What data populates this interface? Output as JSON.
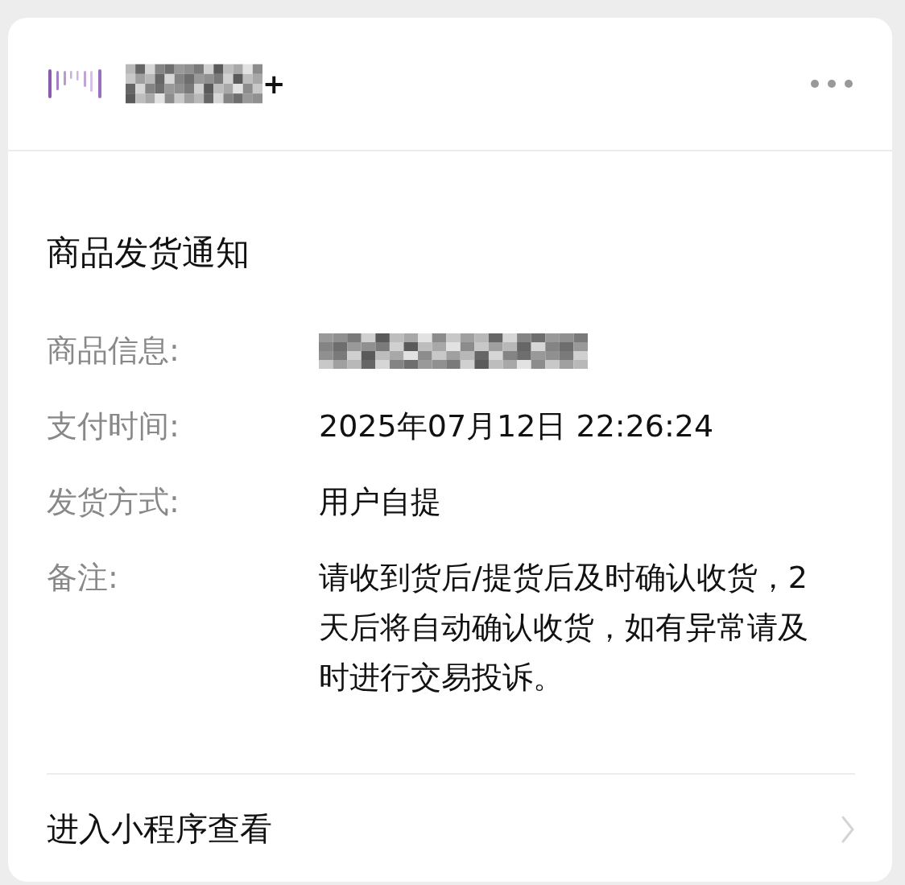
{
  "header": {
    "name_redacted": true,
    "name_suffix": "+"
  },
  "title": "商品发货通知",
  "fields": [
    {
      "label": "商品信息:",
      "kind": "redacted"
    },
    {
      "label": "支付时间:",
      "kind": "text",
      "value": "2025年07月12日 22:26:24"
    },
    {
      "label": "发货方式:",
      "kind": "text",
      "value": "用户自提"
    },
    {
      "label": "备注:",
      "kind": "text",
      "value": "请收到货后/提货后及时确认收货，2天后将自动确认收货，如有异常请及时进行交易投诉。"
    }
  ],
  "footer": {
    "link": "进入小程序查看"
  }
}
